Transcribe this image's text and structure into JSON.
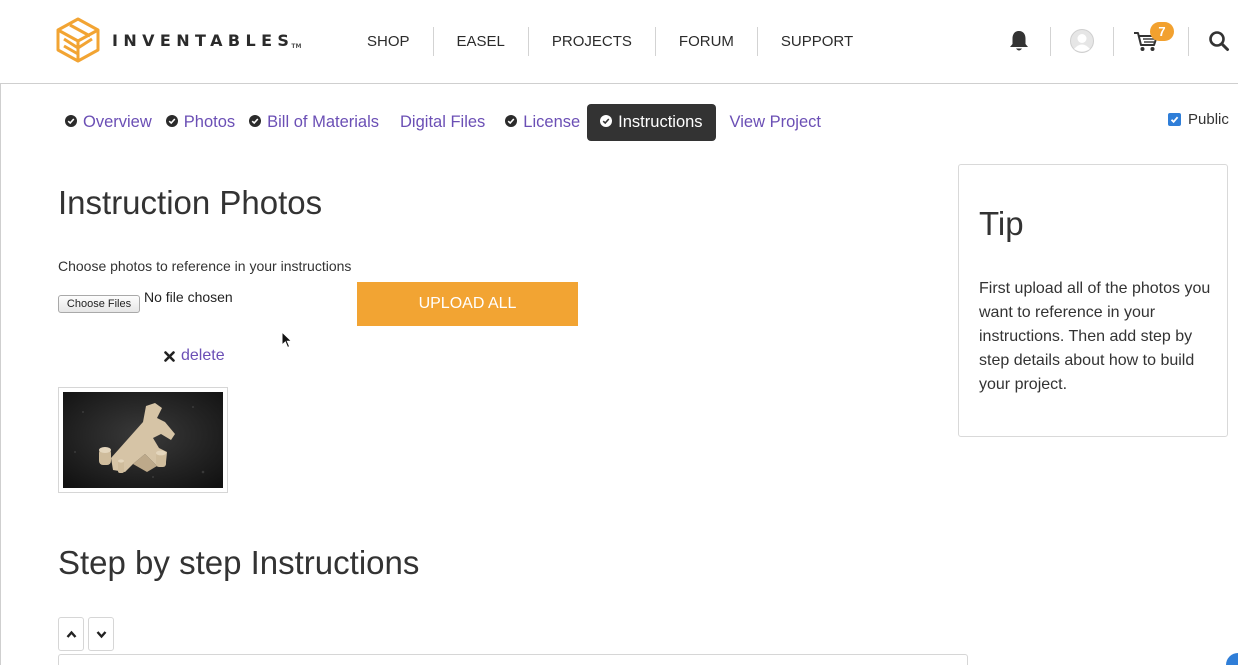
{
  "header": {
    "logo_text": "INVENTABLES",
    "logo_tm": "TM",
    "nav": [
      "SHOP",
      "EASEL",
      "PROJECTS",
      "FORUM",
      "SUPPORT"
    ],
    "cart_count": "7"
  },
  "tabs": {
    "items": [
      {
        "label": "Overview",
        "checked": true
      },
      {
        "label": "Photos",
        "checked": true
      },
      {
        "label": "Bill of Materials",
        "checked": true
      },
      {
        "label": "Digital Files",
        "checked": false
      },
      {
        "label": "License",
        "checked": true
      },
      {
        "label": "Instructions",
        "checked": true,
        "active": true
      },
      {
        "label": "View Project",
        "checked": false
      }
    ],
    "public_label": "Public",
    "public_checked": true
  },
  "photos": {
    "heading": "Instruction Photos",
    "subtitle": "Choose photos to reference in your instructions",
    "choose_files_label": "Choose Files",
    "no_file_text": "No file chosen",
    "upload_label": "UPLOAD ALL",
    "delete_label": "delete"
  },
  "steps": {
    "heading": "Step by step Instructions"
  },
  "tip": {
    "title": "Tip",
    "body": "First upload all of the photos you want to reference in your instructions. Then add step by step details about how to build your project."
  },
  "colors": {
    "accent_orange": "#f2a433",
    "link_purple": "#6b4fb5",
    "active_tab_bg": "#333333",
    "checkbox_blue": "#2f7ed8"
  },
  "icons": {
    "logo": "inventables-cube-icon",
    "bell": "bell-icon",
    "avatar": "user-avatar-icon",
    "cart": "cart-icon",
    "search": "search-icon",
    "tab_check": "check-circle-icon",
    "delete": "close-icon",
    "up": "chevron-up-icon",
    "down": "chevron-down-icon"
  }
}
